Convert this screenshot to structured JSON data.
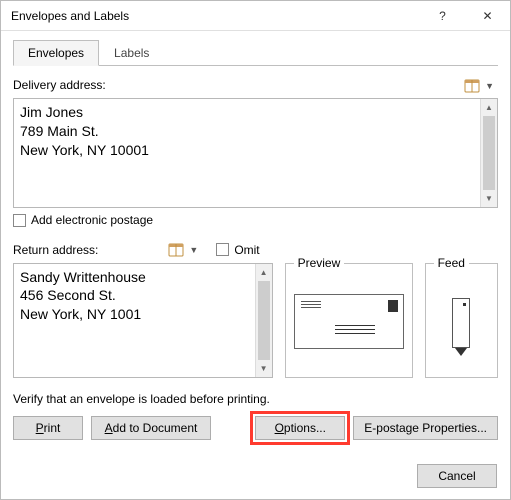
{
  "window": {
    "title": "Envelopes and Labels",
    "help_symbol": "?",
    "close_symbol": "✕"
  },
  "tabs": {
    "envelopes": "Envelopes",
    "labels": "Labels",
    "active": "envelopes"
  },
  "delivery": {
    "label": "Delivery address:",
    "value": "Jim Jones\n789 Main St.\nNew York, NY 10001"
  },
  "electronic_postage": {
    "label": "Add electronic postage",
    "checked": false
  },
  "return": {
    "label": "Return address:",
    "value": "Sandy Writtenhouse\n456 Second St.\nNew York, NY 1001"
  },
  "omit": {
    "label": "Omit",
    "checked": false
  },
  "preview": {
    "label": "Preview"
  },
  "feed": {
    "label": "Feed"
  },
  "verify_text": "Verify that an envelope is loaded before printing.",
  "buttons": {
    "print": "Print",
    "add_to_document": "Add to Document",
    "options": "Options...",
    "epostage": "E-postage Properties...",
    "cancel": "Cancel"
  }
}
